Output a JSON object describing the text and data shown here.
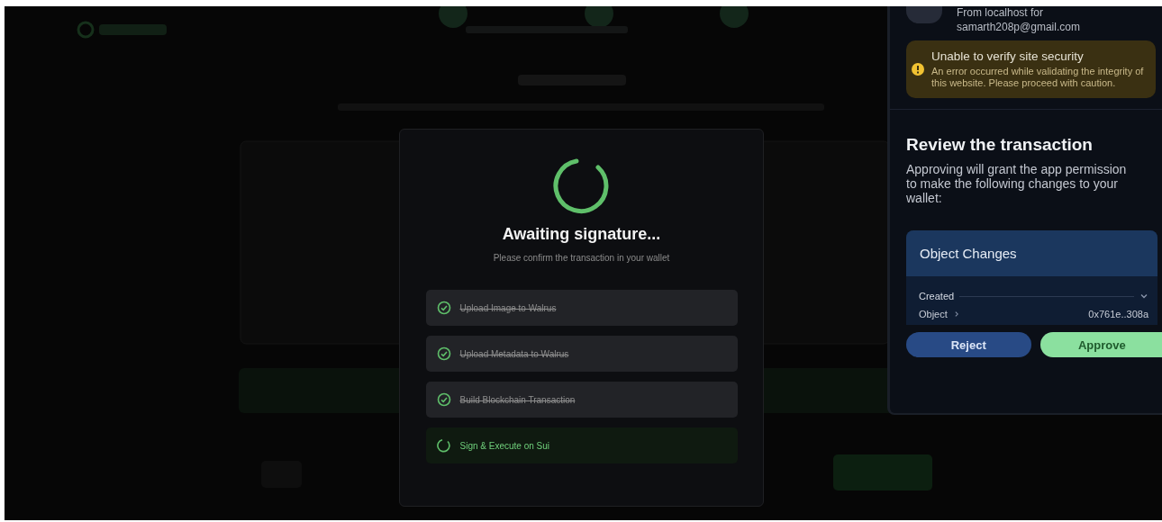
{
  "modal": {
    "title": "Awaiting signature...",
    "subtitle": "Please confirm the transaction in your wallet",
    "steps": [
      {
        "label": "Upload Image to Walrus",
        "kind": "done"
      },
      {
        "label": "Upload Metadata to Walrus",
        "kind": "done"
      },
      {
        "label": "Build Blockchain Transaction",
        "kind": "done"
      },
      {
        "label": "Sign & Execute on Sui",
        "kind": "active"
      }
    ]
  },
  "wallet": {
    "origin": "From localhost for",
    "account": "samarth208p@gmail.com",
    "warning": {
      "title": "Unable to verify site security",
      "body": "An error occurred while validating the integrity of this website. Please proceed with caution."
    },
    "review": {
      "title": "Review the transaction",
      "body": "Approving will grant the app permission to make the following changes to your wallet:"
    },
    "object_changes": {
      "title": "Object Changes",
      "group": "Created",
      "expanded": true,
      "rows": [
        {
          "label": "Object",
          "value": "0x761e..308a"
        }
      ]
    },
    "buttons": [
      {
        "label": "Reject",
        "kind": "secondary"
      },
      {
        "label": "Approve",
        "kind": "primary"
      }
    ]
  }
}
